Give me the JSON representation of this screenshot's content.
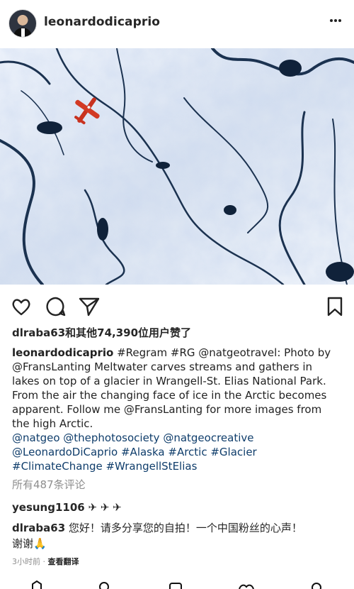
{
  "header": {
    "username": "leonardodicaprio"
  },
  "icons": {
    "more": "more-horizontal-icon",
    "like": "heart-icon",
    "comment": "comment-bubble-icon",
    "share": "paper-plane-icon",
    "save": "bookmark-icon"
  },
  "likes": {
    "text": "dlraba63和其他74,390位用户赞了"
  },
  "caption": {
    "username": "leonardodicaprio",
    "line1_rest": " #Regram #RG @natgeotravel: Photo by",
    "line2": "@FransLanting Meltwater carves streams and gathers in",
    "line3": "lakes on top of a glacier in Wrangell-St. Elias National Park.",
    "line4": "From the air the changing face of ice in the Arctic becomes",
    "line5": "apparent. Follow me @FransLanting for more images from",
    "line6": "the high Arctic.",
    "line7": "@natgeo @thephotosociety @natgeocreative",
    "line8": "@LeonardoDiCaprio #Alaska #Arctic #Glacier",
    "line9": "#ClimateChange #WrangellStElias"
  },
  "comments_link": "所有487条评论",
  "comments": [
    {
      "username": "yesung1106",
      "text": " ✈ ✈ ✈"
    },
    {
      "username": "dlraba63",
      "text": " 您好！请多分享您的自拍！一个中国粉丝的心声！",
      "text_line2": "谢谢🙏"
    }
  ],
  "timestamp": {
    "time": "3小时前",
    "separator": " · ",
    "translate": "查看翻译"
  },
  "colors": {
    "tag": "#0f3d6b",
    "muted": "#8e8e8e",
    "ice": "#dfe8f5",
    "water": "#1c3552"
  }
}
